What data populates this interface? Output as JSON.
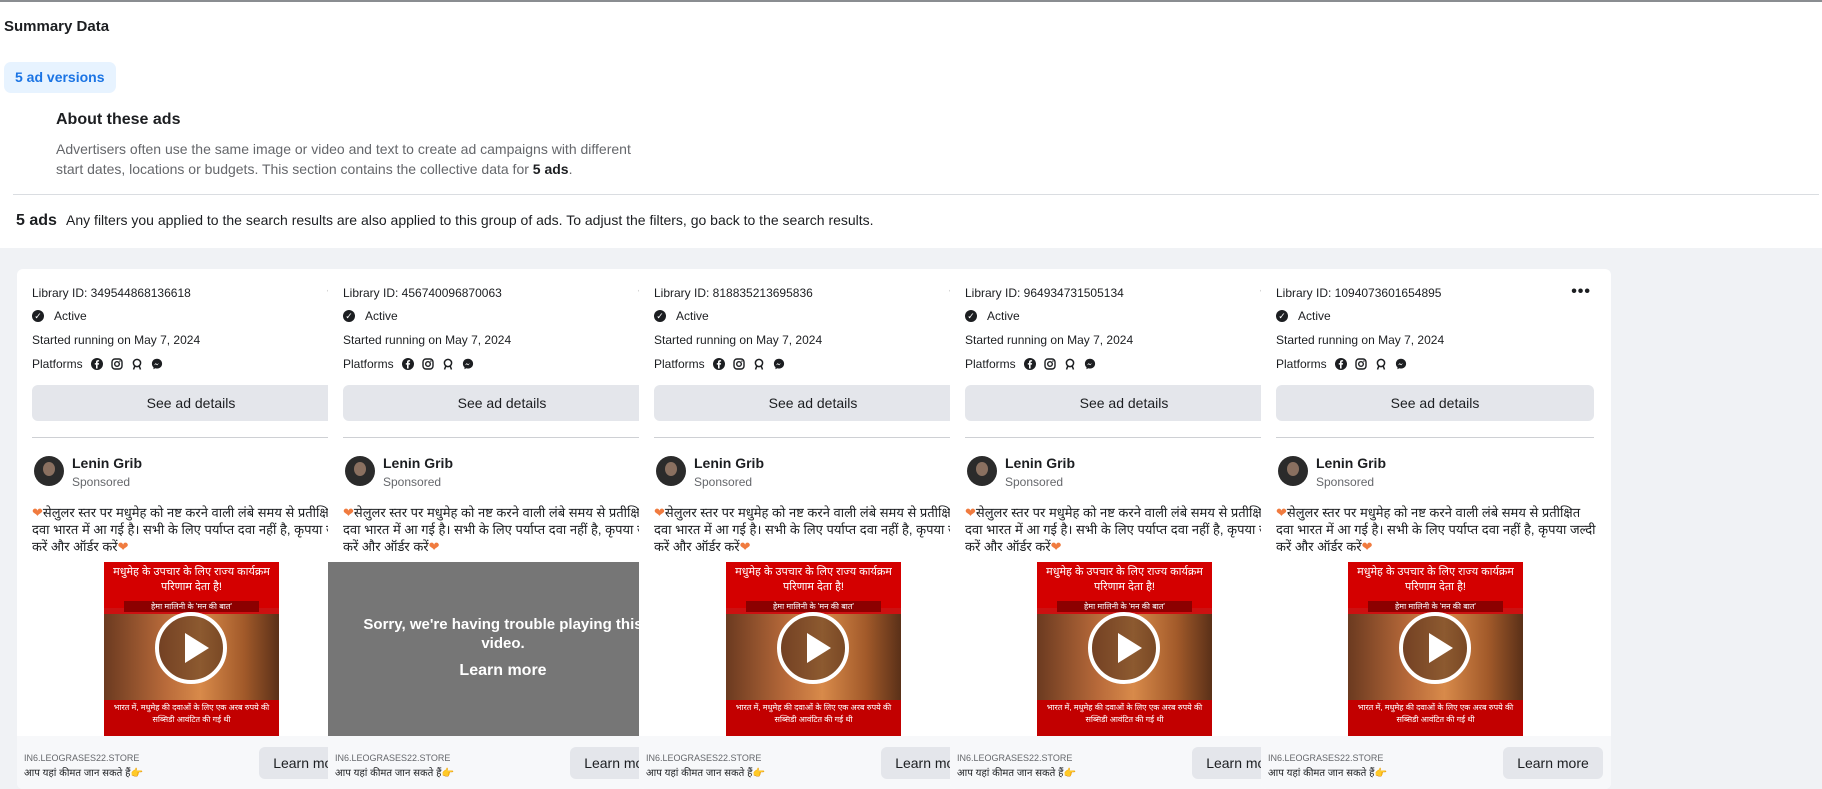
{
  "summary": {
    "title": "Summary Data",
    "versions_badge": "5 ad versions",
    "about_title": "About these ads",
    "about_text_1": "Advertisers often use the same image or video and text to create ad campaigns with different",
    "about_text_2": "start dates, locations or budgets. This section contains the collective data for",
    "about_text_count": "5 ads",
    "about_text_end": "."
  },
  "results": {
    "count": "5 ads",
    "note": "Any filters you applied to the search results are also applied to this group of ads. To adjust the filters, go back to the search results."
  },
  "card_common": {
    "status": "Active",
    "started": "Started running on May 7, 2024",
    "platforms_label": "Platforms",
    "platform_icons": [
      "facebook-icon",
      "instagram-icon",
      "audience-network-icon",
      "messenger-icon"
    ],
    "details_button": "See ad details",
    "advertiser": "Lenin Grib",
    "sponsored": "Sponsored",
    "ad_text": "सेलुलर स्तर पर मधुमेह को नष्ट करने वाली लंबे समय से प्रतीक्षित दवा भारत में आ गई है। सभी के लिए पर्याप्त दवा नहीं है, कृपया जल्दी करें और ऑर्डर करें",
    "thumb_title": "मधुमेह के उपचार के लिए राज्य कार्यक्रम परिणाम देता है!",
    "thumb_sub": "हेमा मालिनी के 'मन की बात'",
    "thumb_bottom": "भारत में, मधुमेह की दवाओं के लिए एक अरब रुपये की सब्सिडी आवंटित की गई थी",
    "domain": "IN6.LEOGRASES22.STORE",
    "cta_caption": "आप यहां कीमत जान सकते हैं👉",
    "learn_more": "Learn more",
    "video_error": "Sorry, we're having trouble playing this video.",
    "video_error_link": "Learn more"
  },
  "cards": [
    {
      "library_id": "Library ID: 349544868136618",
      "video_error": false
    },
    {
      "library_id": "Library ID: 456740096870063",
      "video_error": true
    },
    {
      "library_id": "Library ID: 818835213695836",
      "video_error": false
    },
    {
      "library_id": "Library ID: 964934731505134",
      "video_error": false
    },
    {
      "library_id": "Library ID: 1094073601654895",
      "video_error": false
    }
  ],
  "colors": {
    "badge_bg": "#e7f3ff",
    "badge_text": "#1b74e4",
    "page_grey": "#f0f2f5",
    "heart": "#f07b3f",
    "thumb_red": "#d40000"
  }
}
